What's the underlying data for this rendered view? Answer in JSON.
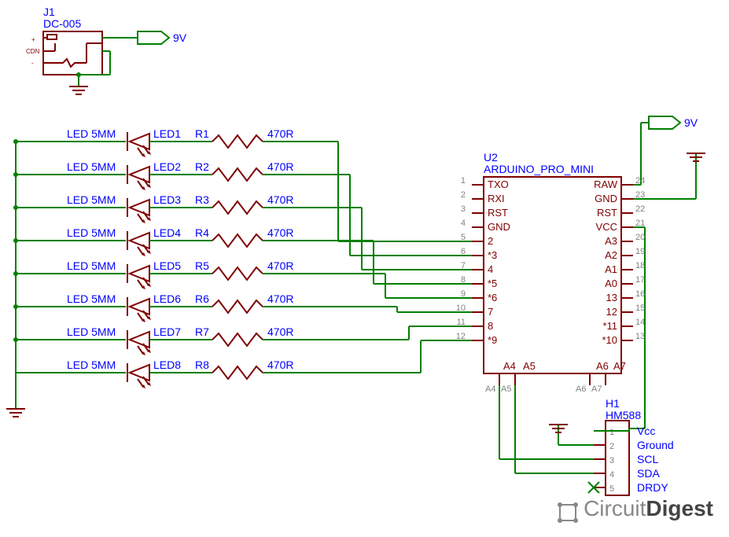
{
  "connector": {
    "ref": "J1",
    "part": "DC-005",
    "pin_plus": "+",
    "pin_cdn": "CDN",
    "pin_minus": "-",
    "net": "9V"
  },
  "leds": [
    {
      "type": "LED 5MM",
      "ref": "LED1",
      "res_ref": "R1",
      "res_val": "470R"
    },
    {
      "type": "LED 5MM",
      "ref": "LED2",
      "res_ref": "R2",
      "res_val": "470R"
    },
    {
      "type": "LED 5MM",
      "ref": "LED3",
      "res_ref": "R3",
      "res_val": "470R"
    },
    {
      "type": "LED 5MM",
      "ref": "LED4",
      "res_ref": "R4",
      "res_val": "470R"
    },
    {
      "type": "LED 5MM",
      "ref": "LED5",
      "res_ref": "R5",
      "res_val": "470R"
    },
    {
      "type": "LED 5MM",
      "ref": "LED6",
      "res_ref": "R6",
      "res_val": "470R"
    },
    {
      "type": "LED 5MM",
      "ref": "LED7",
      "res_ref": "R7",
      "res_val": "470R"
    },
    {
      "type": "LED 5MM",
      "ref": "LED8",
      "res_ref": "R8",
      "res_val": "470R"
    }
  ],
  "mcu": {
    "ref": "U2",
    "part": "ARDUINO_PRO_MINI",
    "left_pins": [
      {
        "num": "1",
        "name": "TXO"
      },
      {
        "num": "2",
        "name": "RXI"
      },
      {
        "num": "3",
        "name": "RST"
      },
      {
        "num": "4",
        "name": "GND"
      },
      {
        "num": "5",
        "name": "2"
      },
      {
        "num": "6",
        "name": "*3"
      },
      {
        "num": "7",
        "name": "4"
      },
      {
        "num": "8",
        "name": "*5"
      },
      {
        "num": "9",
        "name": "*6"
      },
      {
        "num": "10",
        "name": "7"
      },
      {
        "num": "11",
        "name": "8"
      },
      {
        "num": "12",
        "name": "*9"
      }
    ],
    "right_pins": [
      {
        "num": "24",
        "name": "RAW"
      },
      {
        "num": "23",
        "name": "GND"
      },
      {
        "num": "22",
        "name": "RST"
      },
      {
        "num": "21",
        "name": "VCC"
      },
      {
        "num": "20",
        "name": "A3"
      },
      {
        "num": "19",
        "name": "A2"
      },
      {
        "num": "18",
        "name": "A1"
      },
      {
        "num": "17",
        "name": "A0"
      },
      {
        "num": "16",
        "name": "13"
      },
      {
        "num": "15",
        "name": "12"
      },
      {
        "num": "14",
        "name": "*11"
      },
      {
        "num": "13",
        "name": "*10"
      }
    ],
    "bottom_pins": [
      {
        "num": "A4",
        "name": "A4"
      },
      {
        "num": "A5",
        "name": "A5"
      },
      {
        "num": "A7",
        "name": "A7"
      },
      {
        "num": "A6",
        "name": "A6"
      }
    ],
    "net": "9V"
  },
  "sensor": {
    "ref": "H1",
    "part": "HM588",
    "pins": [
      {
        "num": "1",
        "name": "Vcc"
      },
      {
        "num": "2",
        "name": "Ground"
      },
      {
        "num": "3",
        "name": "SCL"
      },
      {
        "num": "4",
        "name": "SDA"
      },
      {
        "num": "5",
        "name": "DRDY"
      }
    ]
  },
  "logo": {
    "circuit": "Circuit",
    "digest": "Digest"
  }
}
